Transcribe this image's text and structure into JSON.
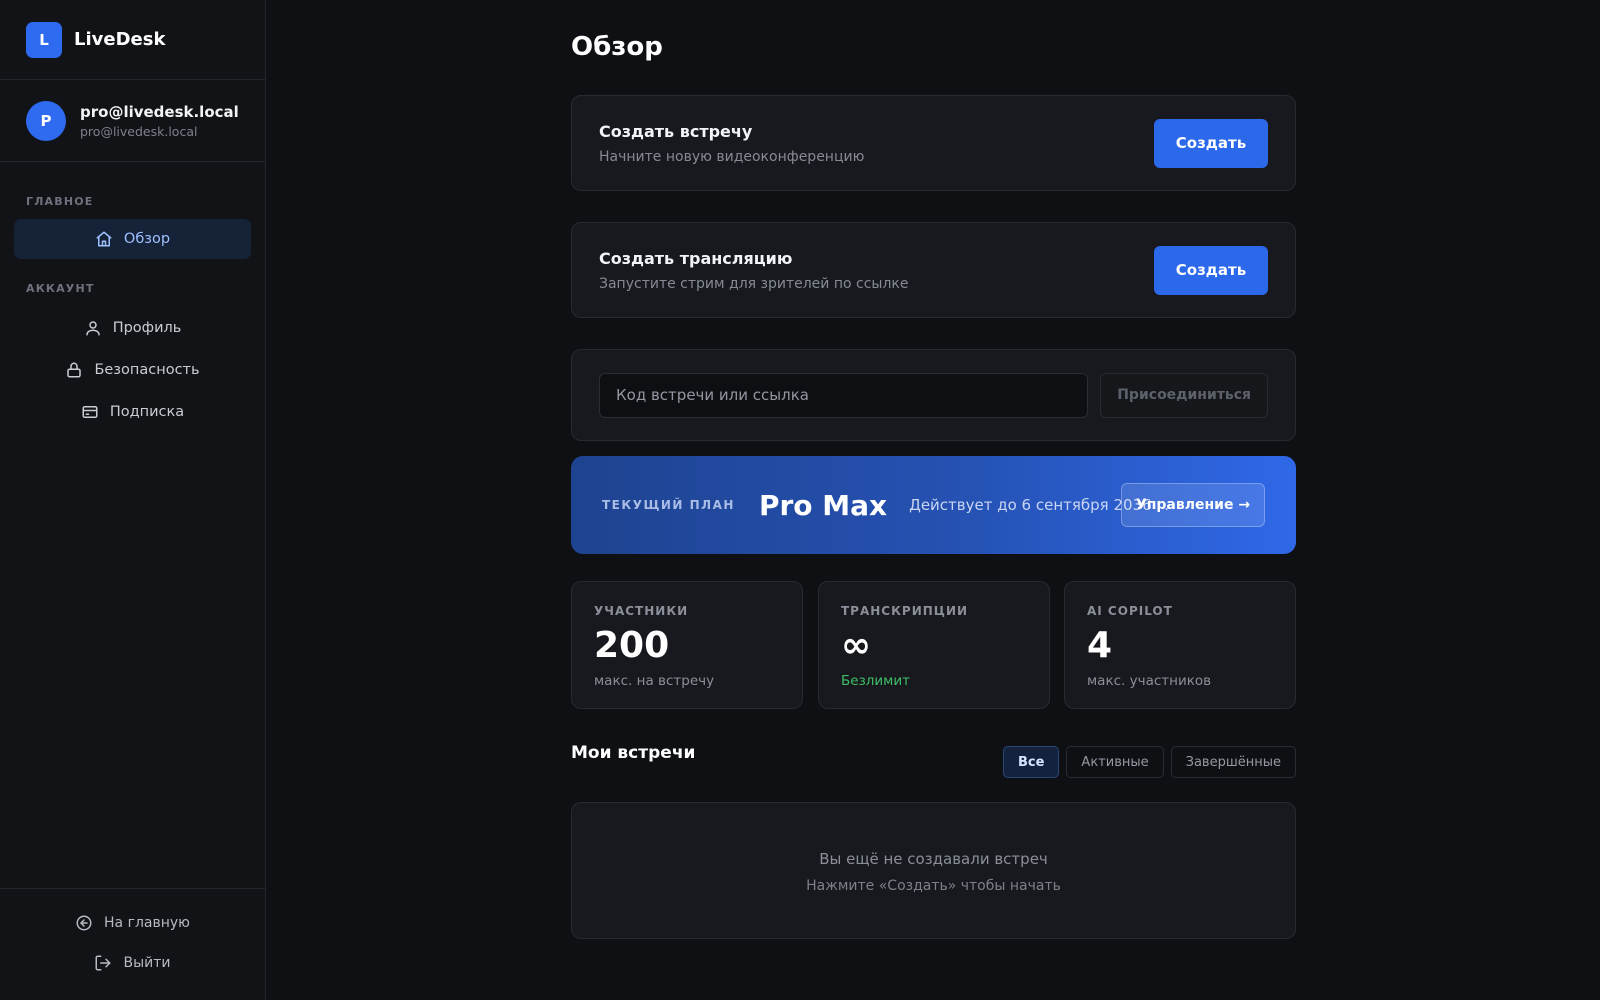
{
  "brand": {
    "logo_letter": "L",
    "name": "LiveDesk",
    "accent": "#2f6bf0"
  },
  "user": {
    "avatar_letter": "P",
    "name": "pro@livedesk.local",
    "email": "pro@livedesk.local"
  },
  "sidebar": {
    "sections": [
      {
        "label": "ГЛАВНОЕ",
        "items": [
          {
            "label": "Обзор",
            "icon": "home-icon",
            "active": true
          }
        ]
      },
      {
        "label": "АККАУНТ",
        "items": [
          {
            "label": "Профиль",
            "icon": "user-icon"
          },
          {
            "label": "Безопасность",
            "icon": "lock-icon"
          },
          {
            "label": "Подписка",
            "icon": "credit-card-icon"
          }
        ]
      }
    ],
    "bottom": [
      {
        "label": "На главную",
        "icon": "arrow-left-circle-icon"
      },
      {
        "label": "Выйти",
        "icon": "logout-icon"
      }
    ]
  },
  "main": {
    "title": "Обзор",
    "create_meeting": {
      "title": "Создать встречу",
      "subtitle": "Начните новую видеоконференцию",
      "button": "Создать"
    },
    "create_stream": {
      "title": "Создать трансляцию",
      "subtitle": "Запустите стрим для зрителей по ссылке",
      "button": "Создать"
    },
    "join": {
      "placeholder": "Код встречи или ссылка",
      "button": "Присоединиться"
    },
    "plan": {
      "label": "ТЕКУЩИЙ ПЛАН",
      "name": "Pro Max",
      "valid_until": "Действует до 6 сентября 2036 г.",
      "button": "Управление →"
    },
    "stats": [
      {
        "label": "УЧАСТНИКИ",
        "value": "200",
        "note": "макс. на встречу"
      },
      {
        "label": "ТРАНСКРИПЦИИ",
        "value": "∞",
        "note": "Безлимит",
        "note_color": "#3fbf66"
      },
      {
        "label": "AI COPILOT",
        "value": "4",
        "note": "макс. участников"
      }
    ],
    "meetings": {
      "title": "Мои встречи",
      "filters": [
        {
          "label": "Все",
          "active": true
        },
        {
          "label": "Активные"
        },
        {
          "label": "Завершённые"
        }
      ],
      "empty_line1": "Вы ещё не создавали встреч",
      "empty_line2": "Нажмите «Создать» чтобы начать"
    }
  }
}
